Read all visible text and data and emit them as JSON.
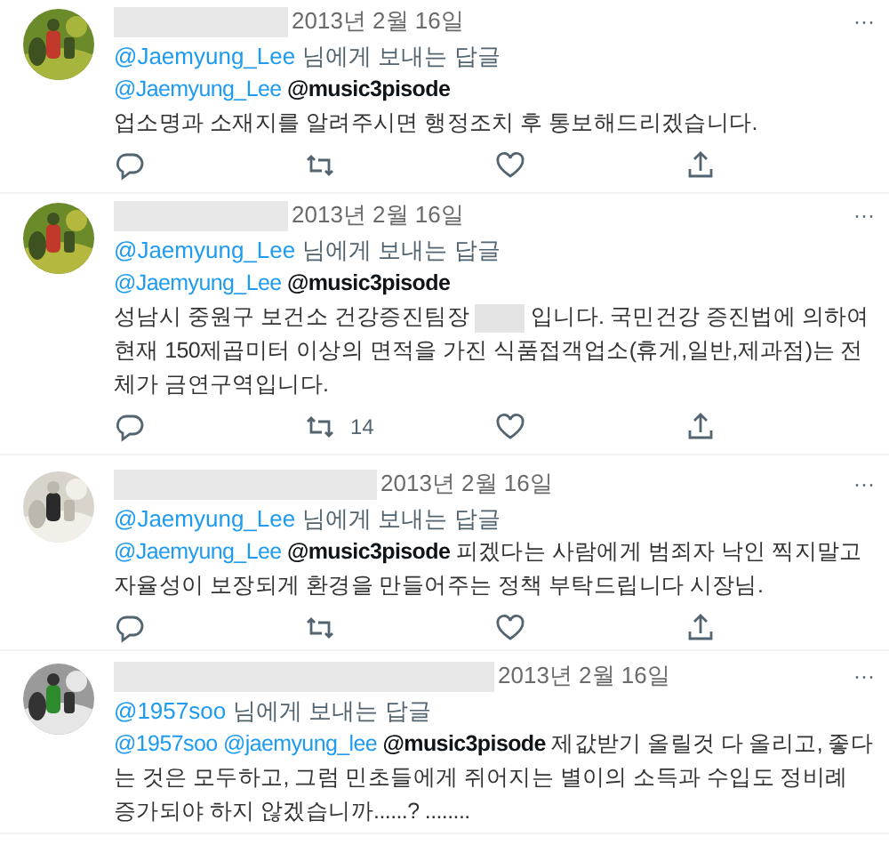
{
  "tweets": [
    {
      "avatar": {
        "kind": "picture"
      },
      "date": "2013년 2월 16일",
      "more": "···",
      "reply_to": {
        "handle": "@Jaemyung_Lee",
        "text": "님에게 보내는 답글"
      },
      "body": [
        {
          "kind": "mention",
          "text": "@Jaemyung_Lee"
        },
        {
          "kind": "bold_mention",
          "text": "@music3pisode"
        },
        {
          "kind": "break"
        },
        {
          "kind": "text",
          "text": "업소명과 소재지를 알려주시면 행정조치 후 통보해드리겠습니다."
        }
      ],
      "actions": [
        {
          "kind": "reply"
        },
        {
          "kind": "retweet"
        },
        {
          "kind": "like"
        },
        {
          "kind": "share"
        }
      ]
    },
    {
      "avatar": {
        "kind": "picture"
      },
      "date": "2013년 2월 16일",
      "more": "···",
      "reply_to": {
        "handle": "@Jaemyung_Lee",
        "text": "님에게 보내는 답글"
      },
      "body": [
        {
          "kind": "mention",
          "text": "@Jaemyung_Lee"
        },
        {
          "kind": "bold_mention",
          "text": "@music3pisode"
        },
        {
          "kind": "break"
        },
        {
          "kind": "text",
          "text": "성남시 중원구 보건소 건강증진팀장"
        },
        {
          "kind": "redacted"
        },
        {
          "kind": "text",
          "text": "입니다. 국민건강 증진법에 의하여 현재 150제곱미터 이상의 면적을 가진 식품접객업소(휴게,일반,제과점)는 전체가 금연구역입니다."
        }
      ],
      "actions": [
        {
          "kind": "reply"
        },
        {
          "kind": "retweet",
          "count": "14"
        },
        {
          "kind": "like"
        },
        {
          "kind": "share"
        }
      ]
    },
    {
      "avatar": {
        "kind": "picture"
      },
      "date": "2013년 2월 16일",
      "more": "···",
      "reply_to": {
        "handle": "@Jaemyung_Lee",
        "text": "님에게 보내는 답글"
      },
      "body": [
        {
          "kind": "mention",
          "text": "@Jaemyung_Lee"
        },
        {
          "kind": "bold_mention",
          "text": "@music3pisode"
        },
        {
          "kind": "text",
          "text": "피겠다는 사람에게 범죄자 낙인 찍지말고 자율성이 보장되게 환경을 만들어주는 정책 부탁드립니다 시장님."
        }
      ],
      "actions": [
        {
          "kind": "reply"
        },
        {
          "kind": "retweet"
        },
        {
          "kind": "like"
        },
        {
          "kind": "share"
        }
      ]
    },
    {
      "avatar": {
        "kind": "picture"
      },
      "date": "2013년 2월 16일",
      "more": "···",
      "reply_to": {
        "handle": "@1957soo",
        "text": "님에게 보내는 답글"
      },
      "body": [
        {
          "kind": "mention",
          "text": "@1957soo"
        },
        {
          "kind": "mention",
          "text": "@jaemyung_lee"
        },
        {
          "kind": "bold_mention",
          "text": "@music3pisode"
        },
        {
          "kind": "text",
          "text": "제값받기 올릴것  다 올리고, 좋다는 것은  모두하고, 그럼  민초들에게  쥐어지는 별이의  소득과 수입도 정비례 증가되야 하지  않겠습니까......? ........"
        }
      ]
    }
  ]
}
